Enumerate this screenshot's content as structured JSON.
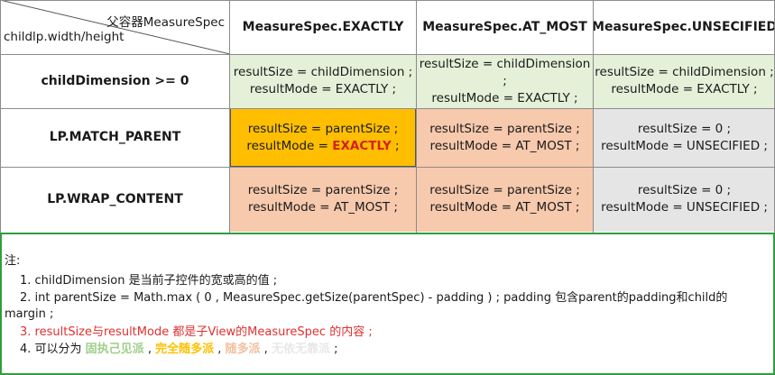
{
  "header": {
    "corner_top": "父容器MeasureSpec",
    "corner_bottom": "childlp.width/height",
    "col1": "MeasureSpec.EXACTLY",
    "col2": "MeasureSpec.AT_MOST",
    "col3": "MeasureSpec.UNSECIFIED"
  },
  "rows": [
    {
      "label": "childDimension >= 0",
      "cells": [
        {
          "line1": "resultSize = childDimension ;",
          "line2": "resultMode = EXACTLY ;"
        },
        {
          "line1": "resultSize = childDimension ;",
          "line2": "resultMode = EXACTLY ;"
        },
        {
          "line1": "resultSize = childDimension ;",
          "line2": "resultMode = EXACTLY ;"
        }
      ]
    },
    {
      "label": "LP.MATCH_PARENT",
      "cells": [
        {
          "line1": "resultSize = parentSize ;",
          "line2_prefix": "resultMode = ",
          "line2_highlight": "EXACTLY",
          "line2_suffix": " ;"
        },
        {
          "line1": "resultSize = parentSize ;",
          "line2": "resultMode = AT_MOST ;"
        },
        {
          "line1": "resultSize = 0 ;",
          "line2": "resultMode = UNSECIFIED ;"
        }
      ]
    },
    {
      "label": "LP.WRAP_CONTENT",
      "cells": [
        {
          "line1": "resultSize = parentSize ;",
          "line2": "resultMode = AT_MOST ;"
        },
        {
          "line1": "resultSize = parentSize ;",
          "line2": "resultMode = AT_MOST ;"
        },
        {
          "line1": "resultSize = 0 ;",
          "line2": "resultMode = UNSECIFIED ;"
        }
      ]
    }
  ],
  "colors": {
    "green": "#e4f0d8",
    "orange": "#ffbf00",
    "peach": "#f7c9ad",
    "gray": "#e5e5e5",
    "note_border": "#2e9e3e",
    "note_red": "#e03030",
    "faction1": "#9fcf8a",
    "faction2": "#ffc000",
    "faction3": "#f2bf9e",
    "faction4": "#e8e8e8"
  },
  "notes": {
    "title": "注:",
    "item1": "1. childDimension 是当前子控件的宽或高的值 ;",
    "item2_line1": "2. int parentSize = Math.max ( 0 , MeasureSpec.getSize(parentSpec) - padding ) ; padding 包含parent的padding和child的",
    "item2_line2": "margin ;",
    "item3_red": "3. resultSize与resultMode 都是子View的MeasureSpec 的内容 ;",
    "item4_prefix": "4. 可以分为 ",
    "faction1": "固执己见派",
    "sep1": " , ",
    "faction2": "完全随多派",
    "sep2": " , ",
    "faction3": "随多派",
    "sep3": " , ",
    "faction4": "无依无靠派",
    "item4_suffix": " ;"
  }
}
